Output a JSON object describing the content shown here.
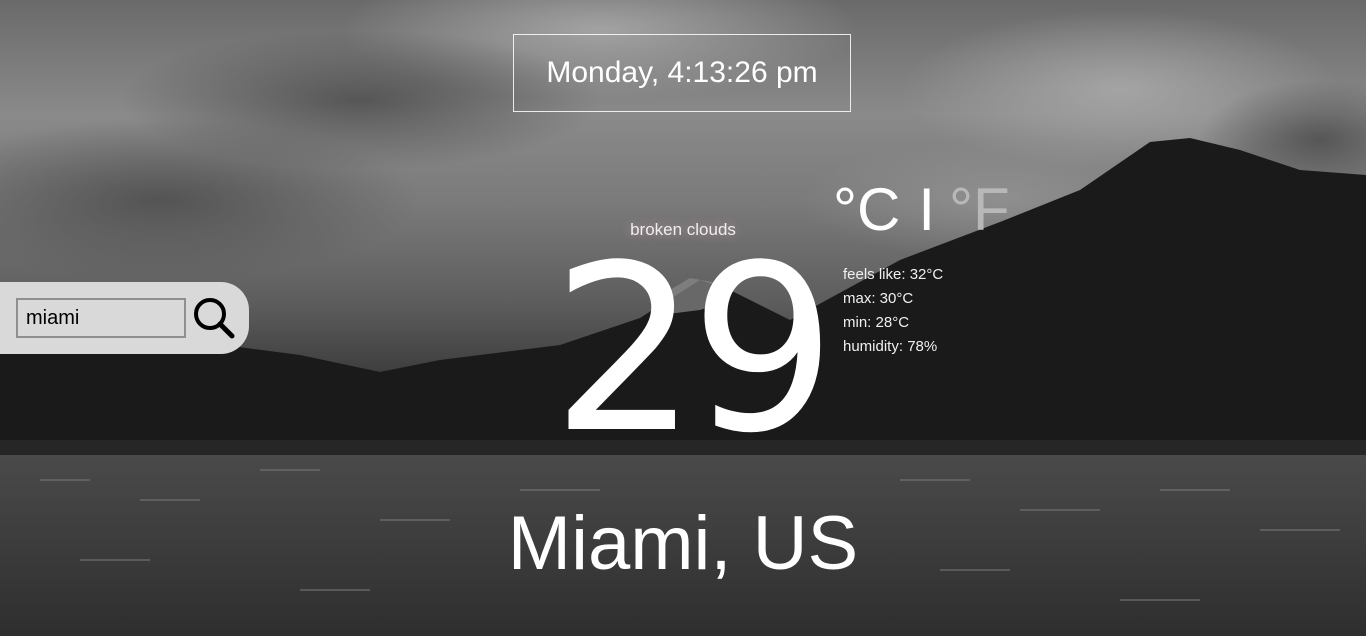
{
  "clock": {
    "text": "Monday, 4:13:26 pm"
  },
  "search": {
    "value": "miami",
    "button_icon": "search-icon"
  },
  "weather": {
    "description": "broken clouds",
    "temperature": "29",
    "location": "Miami, US",
    "units": {
      "celsius": "°C",
      "separator": "I",
      "fahrenheit": "°F"
    },
    "details": [
      {
        "text": "feels like: 32°C"
      },
      {
        "text": "max: 30°C"
      },
      {
        "text": "min: 28°C"
      },
      {
        "text": "humidity: 78%"
      }
    ]
  },
  "colors": {
    "search_panel": "#d9d9d9",
    "inactive_unit": "#b8b8b8",
    "text": "#ffffff"
  }
}
